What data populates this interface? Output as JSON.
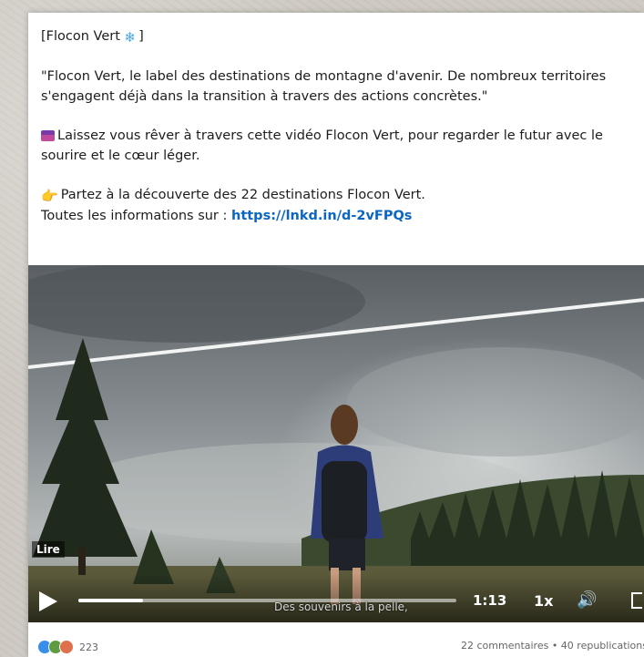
{
  "post": {
    "title": "[Flocon Vert ",
    "title_end": "]",
    "quote": "\"Flocon Vert, le label des destinations de montagne d'avenir. De nombreux territoires s'engagent déjà dans la transition à travers des actions concrètes.\"",
    "video_line": "Laissez vous rêver à travers cette vidéo Flocon Vert, pour regarder le futur avec le sourire et le cœur léger.",
    "discover_line": "Partez à la découverte des 22 destinations Flocon Vert.",
    "info_prefix": "Toutes les informations sur : ",
    "info_link": "https://lnkd.in/d-2vFPQs",
    "icons": {
      "title": "snowflake-icon",
      "video": "clapperboard-icon",
      "discover": "pointing-hand-icon"
    }
  },
  "video": {
    "play_label": "Lire",
    "subtitle": "Des souvenirs à la pelle,",
    "time": "1:13",
    "speed": "1x",
    "progress": 0.17
  },
  "footer": {
    "reaction_count": "223",
    "stats": "22 commentaires • 40 republications"
  },
  "colors": {
    "link": "#0a66c2"
  }
}
